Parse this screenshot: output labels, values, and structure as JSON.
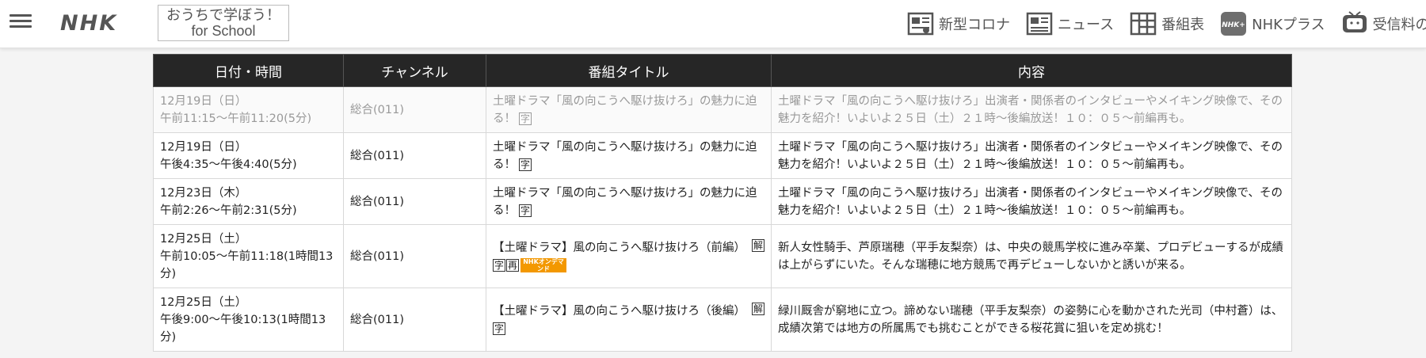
{
  "header": {
    "logo": "NHK",
    "school_button": [
      "おうちで学ぼう！",
      "for School"
    ],
    "nav": [
      {
        "label": "新型コロナ",
        "icon": "virus-news-icon"
      },
      {
        "label": "ニュース",
        "icon": "news-icon"
      },
      {
        "label": "番組表",
        "icon": "grid-schedule-icon"
      },
      {
        "label": "NHKプラス",
        "icon": "nhk-plus-icon"
      },
      {
        "label": "受信料の窓口",
        "icon": "tv-icon"
      }
    ]
  },
  "table": {
    "headers": [
      "日付・時間",
      "チャンネル",
      "番組タイトル",
      "内容"
    ],
    "rows": [
      {
        "date": "12月19日（日）",
        "time": "午前11:15～午前11:20(5分)",
        "channel": "総合(011)",
        "title": "土曜ドラマ「風の向こうへ駆け抜けろ」の魅力に迫る！",
        "badges": [
          "字"
        ],
        "content": "土曜ドラマ「風の向こうへ駆け抜けろ」出演者・関係者のインタビューやメイキング映像で、その魅力を紹介！いよいよ２５日（土）２１時～後編放送！１０：０５～前編再も。"
      },
      {
        "date": "12月19日（日）",
        "time": "午後4:35～午後4:40(5分)",
        "channel": "総合(011)",
        "title": "土曜ドラマ「風の向こうへ駆け抜けろ」の魅力に迫る！",
        "badges": [
          "字"
        ],
        "content": "土曜ドラマ「風の向こうへ駆け抜けろ」出演者・関係者のインタビューやメイキング映像で、その魅力を紹介！いよいよ２５日（土）２１時～後編放送！１０：０５～前編再も。"
      },
      {
        "date": "12月23日（木）",
        "time": "午前2:26～午前2:31(5分)",
        "channel": "総合(011)",
        "title": "土曜ドラマ「風の向こうへ駆け抜けろ」の魅力に迫る！",
        "badges": [
          "字"
        ],
        "content": "土曜ドラマ「風の向こうへ駆け抜けろ」出演者・関係者のインタビューやメイキング映像で、その魅力を紹介！いよいよ２５日（土）２１時～後編放送！１０：０５～前編再も。"
      },
      {
        "date": "12月25日（土）",
        "time": "午前10:05～午前11:18(1時間13分)",
        "channel": "総合(011)",
        "title": "【土曜ドラマ】風の向こうへ駆け抜けろ（前編）",
        "side_badge": "解",
        "badges": [
          "字",
          "再"
        ],
        "ondemand": "NHKオンデマンド",
        "content": "新人女性騎手、芦原瑞穂（平手友梨奈）は、中央の競馬学校に進み卒業、プロデビューするが成績は上がらずにいた。そんな瑞穂に地方競馬で再デビューしないかと誘いが来る。"
      },
      {
        "date": "12月25日（土）",
        "time": "午後9:00～午後10:13(1時間13分)",
        "channel": "総合(011)",
        "title": "【土曜ドラマ】風の向こうへ駆け抜けろ（後編）",
        "side_badge": "解",
        "badges": [
          "字"
        ],
        "content": "緑川厩舎が窮地に立つ。諦めない瑞穂（平手友梨奈）の姿勢に心を動かされた光司（中村蒼）は、成績次第では地方の所属馬でも挑むことができる桜花賞に狙いを定め挑む！"
      }
    ]
  }
}
